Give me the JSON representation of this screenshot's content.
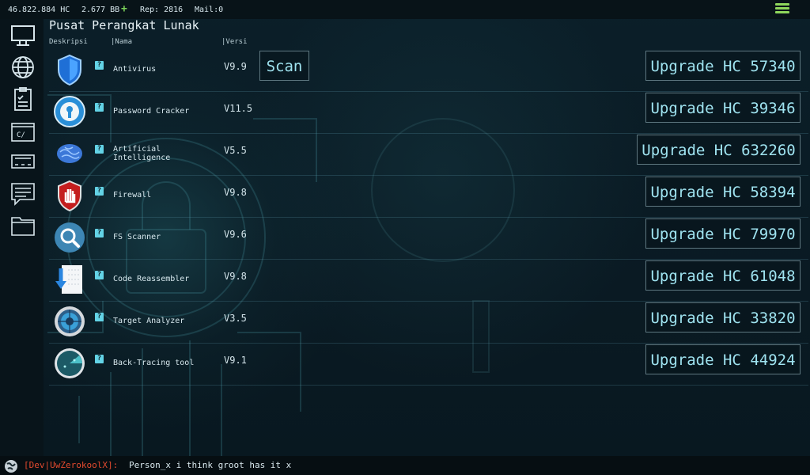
{
  "topbar": {
    "hc": "46.822.884 HC",
    "bb": "2.677 BB",
    "rep": "Rep: 2816",
    "mail": "Mail:0"
  },
  "header": {
    "title": "Pusat Perangkat Lunak",
    "col_desc": "Deskripsi",
    "col_name": "|Nama",
    "col_version": "|Versi"
  },
  "scan_label": "Scan",
  "software": [
    {
      "name": "Antivirus",
      "version": "V9.9",
      "upgrade": "Upgrade HC 57340",
      "icon": "shield-icon"
    },
    {
      "name": "Password Cracker",
      "version": "V11.5",
      "upgrade": "Upgrade HC 39346",
      "icon": "keyhole-icon"
    },
    {
      "name": "Artificial Intelligence",
      "version": "V5.5",
      "upgrade": "Upgrade HC 632260",
      "icon": "brain-icon"
    },
    {
      "name": "Firewall",
      "version": "V9.8",
      "upgrade": "Upgrade HC 58394",
      "icon": "hand-shield-icon"
    },
    {
      "name": "FS Scanner",
      "version": "V9.6",
      "upgrade": "Upgrade HC 79970",
      "icon": "magnifier-icon"
    },
    {
      "name": "Code Reassembler",
      "version": "V9.8",
      "upgrade": "Upgrade HC 61048",
      "icon": "download-doc-icon"
    },
    {
      "name": "Target Analyzer",
      "version": "V3.5",
      "upgrade": "Upgrade HC 33820",
      "icon": "target-icon"
    },
    {
      "name": "Back-Tracing tool",
      "version": "V9.1",
      "upgrade": "Upgrade HC 44924",
      "icon": "radar-icon"
    }
  ],
  "sidebar": [
    "monitor-icon",
    "globe-icon",
    "clipboard-icon",
    "terminal-icon",
    "server-icon",
    "chat-icon",
    "folder-icon"
  ],
  "chat": {
    "user": "[Dev|UwZerokoolX]:",
    "message": "Person_x i think groot has it x"
  },
  "colors": {
    "accent": "#9fe3f0",
    "chat_user": "#e34a2e",
    "plus": "#7bd35a"
  }
}
